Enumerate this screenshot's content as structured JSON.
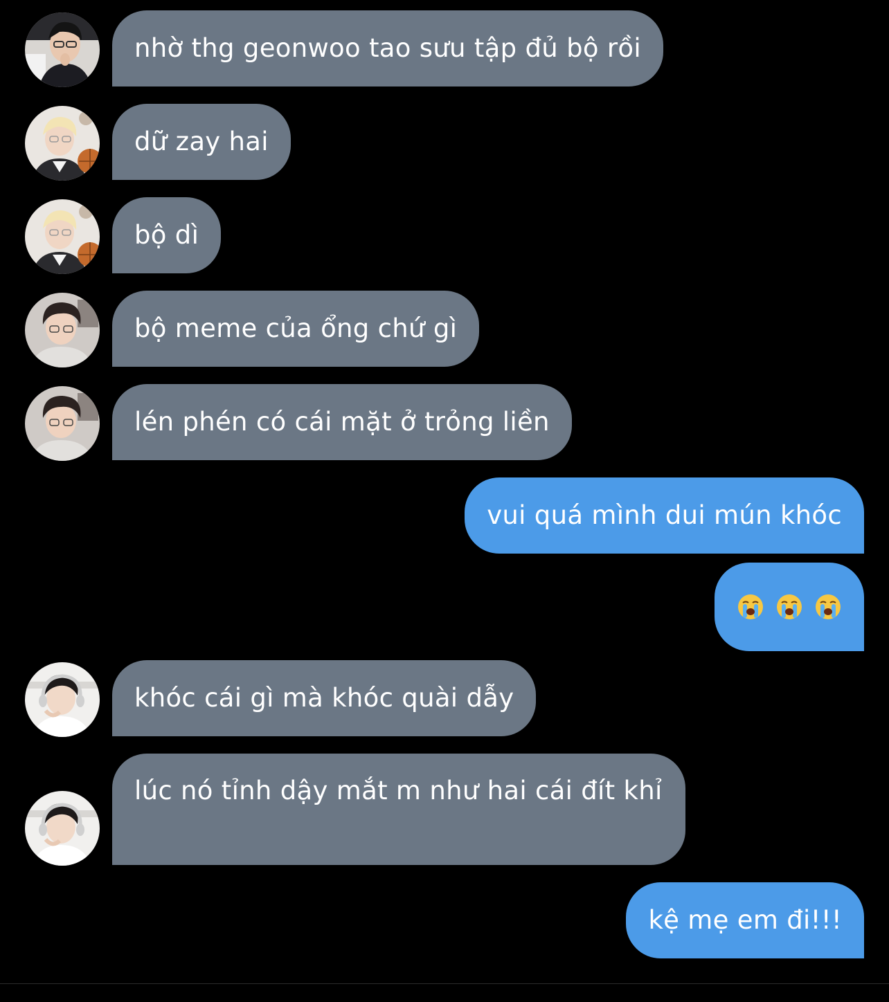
{
  "conversation": {
    "messages": [
      {
        "text": "nhờ thg geonwoo tao sưu tập đủ bộ rồi",
        "direction": "incoming",
        "avatar": "avatar-a"
      },
      {
        "text": "dữ zay hai",
        "direction": "incoming",
        "avatar": "avatar-b"
      },
      {
        "text": "bộ dì",
        "direction": "incoming",
        "avatar": "avatar-b"
      },
      {
        "text": "bộ meme của ổng chứ gì",
        "direction": "incoming",
        "avatar": "avatar-c"
      },
      {
        "text": "lén phén có cái mặt ở trỏng liền",
        "direction": "incoming",
        "avatar": "avatar-c"
      },
      {
        "text": "vui quá mình dui mún khóc",
        "direction": "outgoing"
      },
      {
        "emoji": [
          "loudly-crying-face",
          "loudly-crying-face",
          "loudly-crying-face"
        ],
        "direction": "outgoing"
      },
      {
        "text": "khóc cái gì mà khóc quài dẫy",
        "direction": "incoming",
        "avatar": "avatar-d"
      },
      {
        "text": "lúc nó tỉnh dậy mắt m như hai cái đít khỉ",
        "direction": "incoming",
        "avatar": "avatar-d"
      },
      {
        "text": "kệ mẹ em đi!!!",
        "direction": "outgoing"
      }
    ]
  },
  "colors": {
    "background": "#000000",
    "incoming_bubble": "#6b7785",
    "outgoing_bubble": "#4c9be8",
    "text": "#ffffff"
  }
}
